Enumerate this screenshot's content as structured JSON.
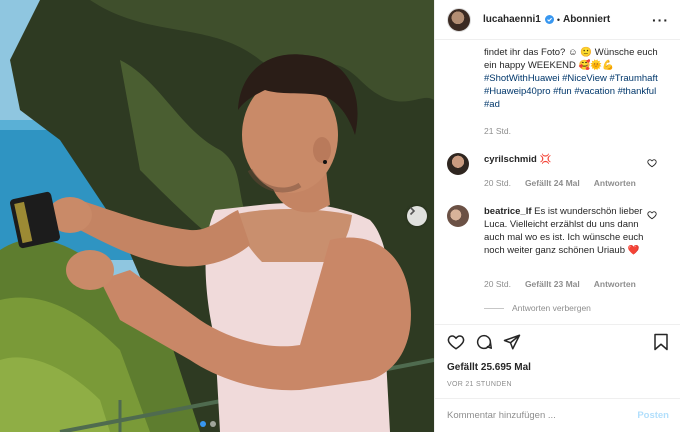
{
  "header": {
    "username": "lucahaenni1",
    "separator": "•",
    "follow_status": "Abonniert",
    "more": "···"
  },
  "caption": {
    "line_text": "findet ihr das Foto? ☺ 🙂 Wünsche euch ein happy WEEKEND 🥰🌞💪",
    "hashtags": "#ShotWithHuawei #NiceView #Traumhaft #Huaweip40pro #fun #vacation #thankful #ad",
    "time": "21 Std."
  },
  "comments": [
    {
      "user": "cyrilschmid",
      "text": "💢",
      "time": "20 Std.",
      "likes": "Gefällt 24 Mal",
      "reply": "Antworten"
    },
    {
      "user": "beatrice_lf",
      "text": "Es ist wunderschön lieber Luca. Vielleicht erzählst du uns dann auch mal wo es ist. Ich wünsche euch noch weiter ganz schönen Uriaub ❤️",
      "time": "20 Std.",
      "likes": "Gefällt 23 Mal",
      "reply": "Antworten"
    }
  ],
  "hide_replies": "Antworten verbergen",
  "likes_count": "Gefällt 25.695 Mal",
  "posted_ago": "VOR 21 STUNDEN",
  "comment_input": {
    "placeholder": "Kommentar hinzufügen ...",
    "value": ""
  },
  "post_button": "Posten",
  "colors": {
    "verified_blue": "#3897f0",
    "hashtag": "#00376b",
    "muted": "#8e8e8e",
    "post_disabled": "#b2dffc"
  },
  "icons": [
    "verified-icon",
    "more-icon",
    "heart-icon",
    "comment-icon",
    "share-icon",
    "bookmark-icon",
    "chevron-right-icon"
  ],
  "carousel": {
    "total": 2,
    "active": 1
  }
}
